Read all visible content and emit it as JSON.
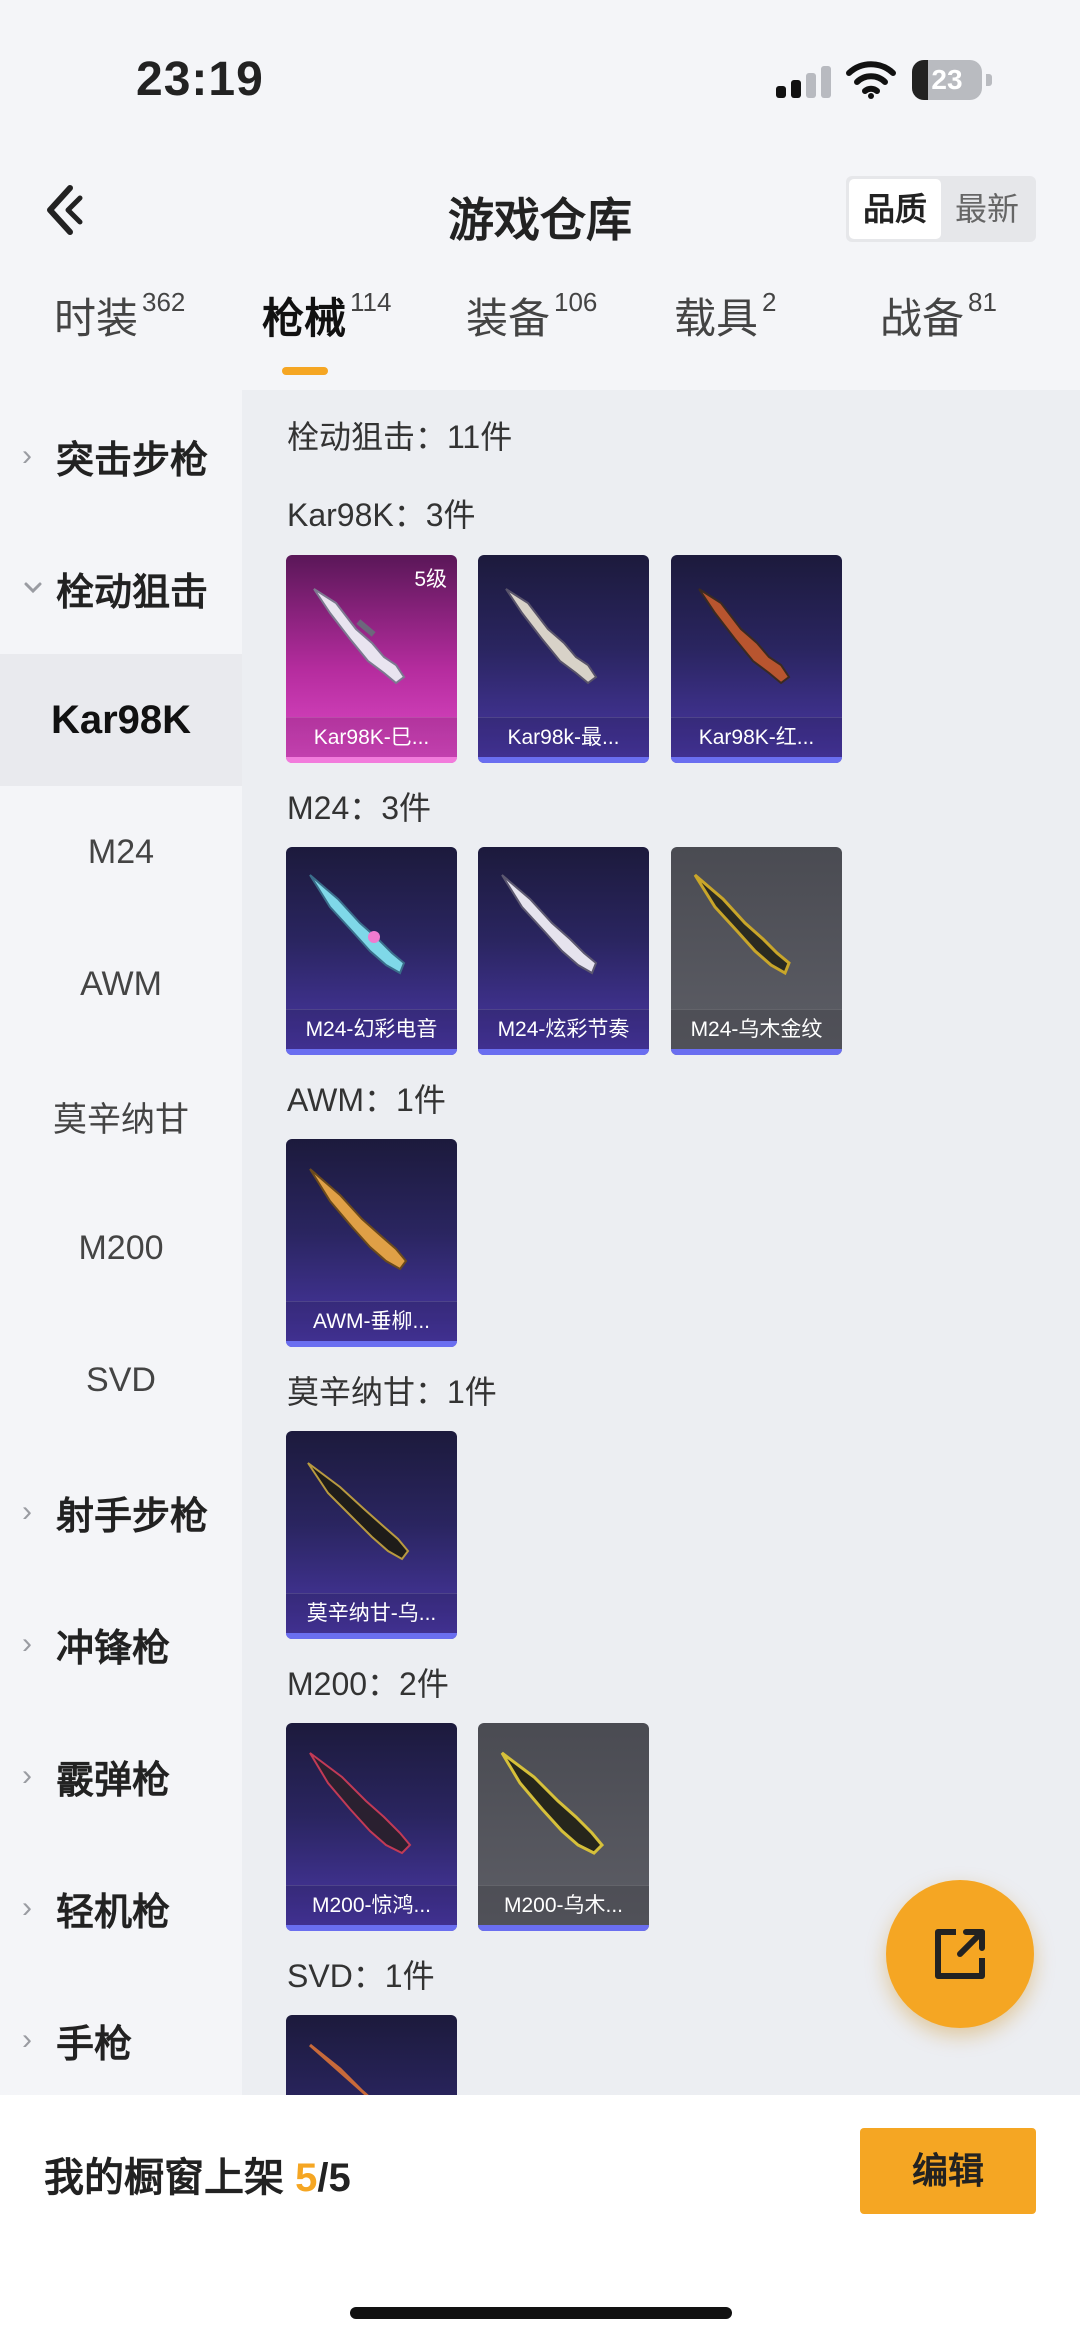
{
  "status": {
    "time": "23:19",
    "battery": "23",
    "battery_level": 0.23
  },
  "header": {
    "title": "游戏仓库",
    "sort_quality": "品质",
    "sort_newest": "最新"
  },
  "tabs": [
    {
      "label": "时装",
      "count": "362"
    },
    {
      "label": "枪械",
      "count": "114"
    },
    {
      "label": "装备",
      "count": "106"
    },
    {
      "label": "载具",
      "count": "2"
    },
    {
      "label": "战备",
      "count": "81"
    }
  ],
  "sidebar": {
    "items": [
      {
        "label": "突击步枪"
      },
      {
        "label": "栓动狙击"
      },
      {
        "label": "Kar98K"
      },
      {
        "label": "M24"
      },
      {
        "label": "AWM"
      },
      {
        "label": "莫辛纳甘"
      },
      {
        "label": "M200"
      },
      {
        "label": "SVD"
      },
      {
        "label": "射手步枪"
      },
      {
        "label": "冲锋枪"
      },
      {
        "label": "霰弹枪"
      },
      {
        "label": "轻机枪"
      },
      {
        "label": "手枪"
      }
    ]
  },
  "main": {
    "category_title": "栓动狙击：11件",
    "sections": [
      {
        "title": "Kar98K：3件",
        "items": [
          {
            "name": "Kar98K-巳...",
            "level": "5级",
            "rarity": "pink"
          },
          {
            "name": "Kar98k-最...",
            "rarity": "purple"
          },
          {
            "name": "Kar98K-红...",
            "rarity": "purple"
          }
        ]
      },
      {
        "title": "M24：3件",
        "items": [
          {
            "name": "M24-幻彩电音",
            "rarity": "purple"
          },
          {
            "name": "M24-炫彩节奏",
            "rarity": "purple"
          },
          {
            "name": "M24-乌木金纹",
            "rarity": "gray"
          }
        ]
      },
      {
        "title": "AWM：1件",
        "items": [
          {
            "name": "AWM-垂柳...",
            "rarity": "purple"
          }
        ]
      },
      {
        "title": "莫辛纳甘：1件",
        "items": [
          {
            "name": "莫辛纳甘-乌...",
            "rarity": "purple"
          }
        ]
      },
      {
        "title": "M200：2件",
        "items": [
          {
            "name": "M200-惊鸿...",
            "rarity": "purple"
          },
          {
            "name": "M200-乌木...",
            "rarity": "gray"
          }
        ]
      },
      {
        "title": "SVD：1件",
        "items": [
          {
            "name": "",
            "rarity": "purple"
          }
        ]
      }
    ]
  },
  "bottom": {
    "showcase_label": "我的橱窗上架 ",
    "showcase_current": "5",
    "showcase_total": "/5",
    "edit_label": "编辑"
  },
  "colors": {
    "accent": "#f5a623",
    "purple_card": "#2a2560",
    "pink_card": "#b52c9e",
    "gray_card": "#5d5e66"
  },
  "icons": [
    "back-icon",
    "signal-icon",
    "wifi-icon",
    "battery-icon",
    "chevron-right-icon",
    "chevron-down-icon",
    "share-export-icon",
    "rifle-icon"
  ]
}
